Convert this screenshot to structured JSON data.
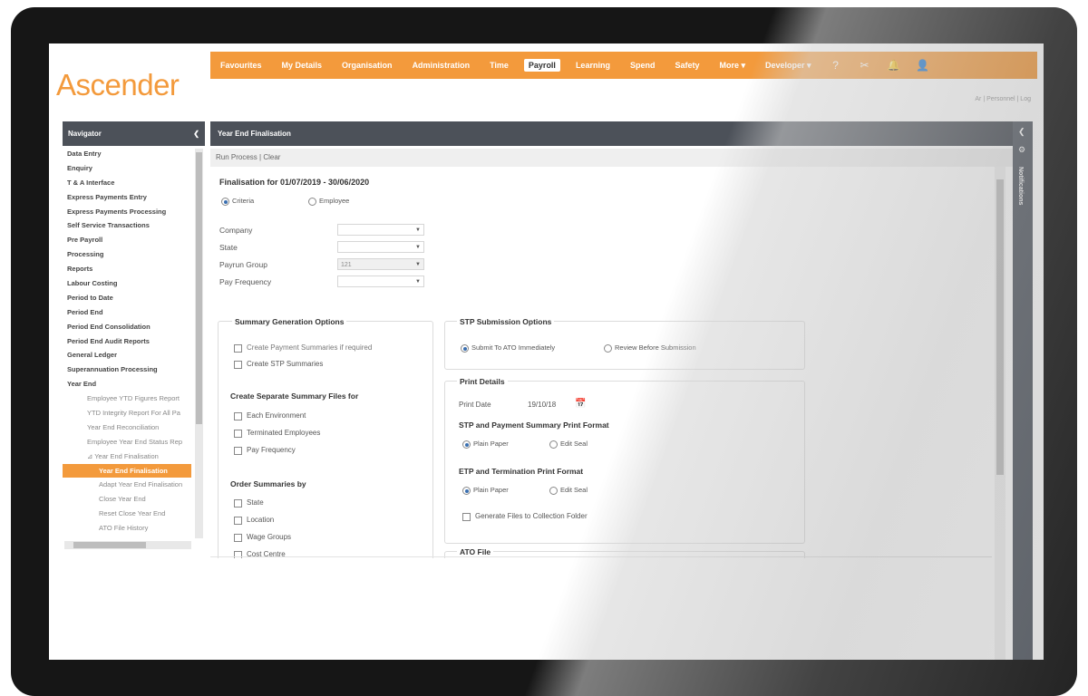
{
  "app": {
    "logo": "Ascender"
  },
  "topnav": {
    "items": [
      "Favourites",
      "My Details",
      "Organisation",
      "Administration",
      "Time",
      "Payroll",
      "Learning",
      "Spend",
      "Safety",
      "More ▾",
      "Developer ▾"
    ],
    "active_index": 5,
    "icons": [
      "help-icon",
      "tools-icon",
      "bell-icon",
      "user-icon"
    ],
    "icon_glyphs": [
      "?",
      "✂",
      "🔔",
      "👤"
    ]
  },
  "breadcrumb": "Ar  |  Personnel  |  Log",
  "navigator": {
    "title": "Navigator",
    "collapse_glyph": "❮",
    "items": [
      {
        "label": "Data Entry",
        "level": 0
      },
      {
        "label": "Enquiry",
        "level": 0
      },
      {
        "label": "T & A Interface",
        "level": 0
      },
      {
        "label": "Express Payments Entry",
        "level": 0
      },
      {
        "label": "Express Payments Processing",
        "level": 0
      },
      {
        "label": "Self Service Transactions",
        "level": 0
      },
      {
        "label": "Pre Payroll",
        "level": 0
      },
      {
        "label": "Processing",
        "level": 0
      },
      {
        "label": "Reports",
        "level": 0
      },
      {
        "label": "Labour Costing",
        "level": 0
      },
      {
        "label": "Period to Date",
        "level": 0
      },
      {
        "label": "Period End",
        "level": 0
      },
      {
        "label": "Period End Consolidation",
        "level": 0
      },
      {
        "label": "Period End Audit Reports",
        "level": 0
      },
      {
        "label": "General Ledger",
        "level": 0
      },
      {
        "label": "Superannuation Processing",
        "level": 0
      },
      {
        "label": "Year End",
        "level": 0
      },
      {
        "label": "Employee YTD Figures Report",
        "level": 1
      },
      {
        "label": "YTD Integrity Report For All Pa",
        "level": 1
      },
      {
        "label": "Year End Reconciliation",
        "level": 1
      },
      {
        "label": "Employee Year End Status Rep",
        "level": 1
      },
      {
        "label": "⊿ Year End Finalisation",
        "level": 1
      },
      {
        "label": "Year End Finalisation",
        "level": 2,
        "active": true
      },
      {
        "label": "Adapt Year End Finalisation",
        "level": 2
      },
      {
        "label": "Close Year End",
        "level": 2
      },
      {
        "label": "Reset Close Year End",
        "level": 2
      },
      {
        "label": "ATO File History",
        "level": 2
      }
    ]
  },
  "panel": {
    "title": "Year End Finalisation",
    "toolbar": "Run Process  |  Clear"
  },
  "form": {
    "heading": "Finalisation for 01/07/2019 - 30/06/2020",
    "mode_options": [
      "Criteria",
      "Employee"
    ],
    "mode_selected": 0,
    "fields": [
      {
        "label": "Company",
        "value": ""
      },
      {
        "label": "State",
        "value": ""
      },
      {
        "label": "Payrun Group",
        "value": "121",
        "disabled": true
      },
      {
        "label": "Pay Frequency",
        "value": ""
      }
    ],
    "summary_options": {
      "title": "Summary Generation Options",
      "items": [
        "Create Payment Summaries if required",
        "Create STP Summaries"
      ]
    },
    "separate_files": {
      "title": "Create Separate Summary Files for",
      "items": [
        "Each Environment",
        "Terminated Employees",
        "Pay Frequency"
      ]
    },
    "order_by": {
      "title": "Order Summaries by",
      "items": [
        "State",
        "Location",
        "Wage Groups",
        "Cost Centre"
      ]
    },
    "stp_submission": {
      "title": "STP Submission Options",
      "options": [
        "Submit To ATO Immediately",
        "Review Before Submission"
      ],
      "selected": 0
    },
    "print_details": {
      "title": "Print Details",
      "print_date_label": "Print Date",
      "print_date_value": "19/10/18",
      "stp_format_title": "STP and Payment Summary Print Format",
      "stp_format_options": [
        "Plain Paper",
        "Edit Seal"
      ],
      "etp_format_title": "ETP and Termination Print Format",
      "etp_format_options": [
        "Plain Paper",
        "Edit Seal"
      ],
      "generate_files": "Generate Files to Collection Folder"
    },
    "ato_file": {
      "title": "ATO File"
    }
  },
  "notifications": {
    "label": "Notifications"
  },
  "colors": {
    "accent": "#f39a3c",
    "header": "#4c5159",
    "sidebar": "#5b616a"
  }
}
